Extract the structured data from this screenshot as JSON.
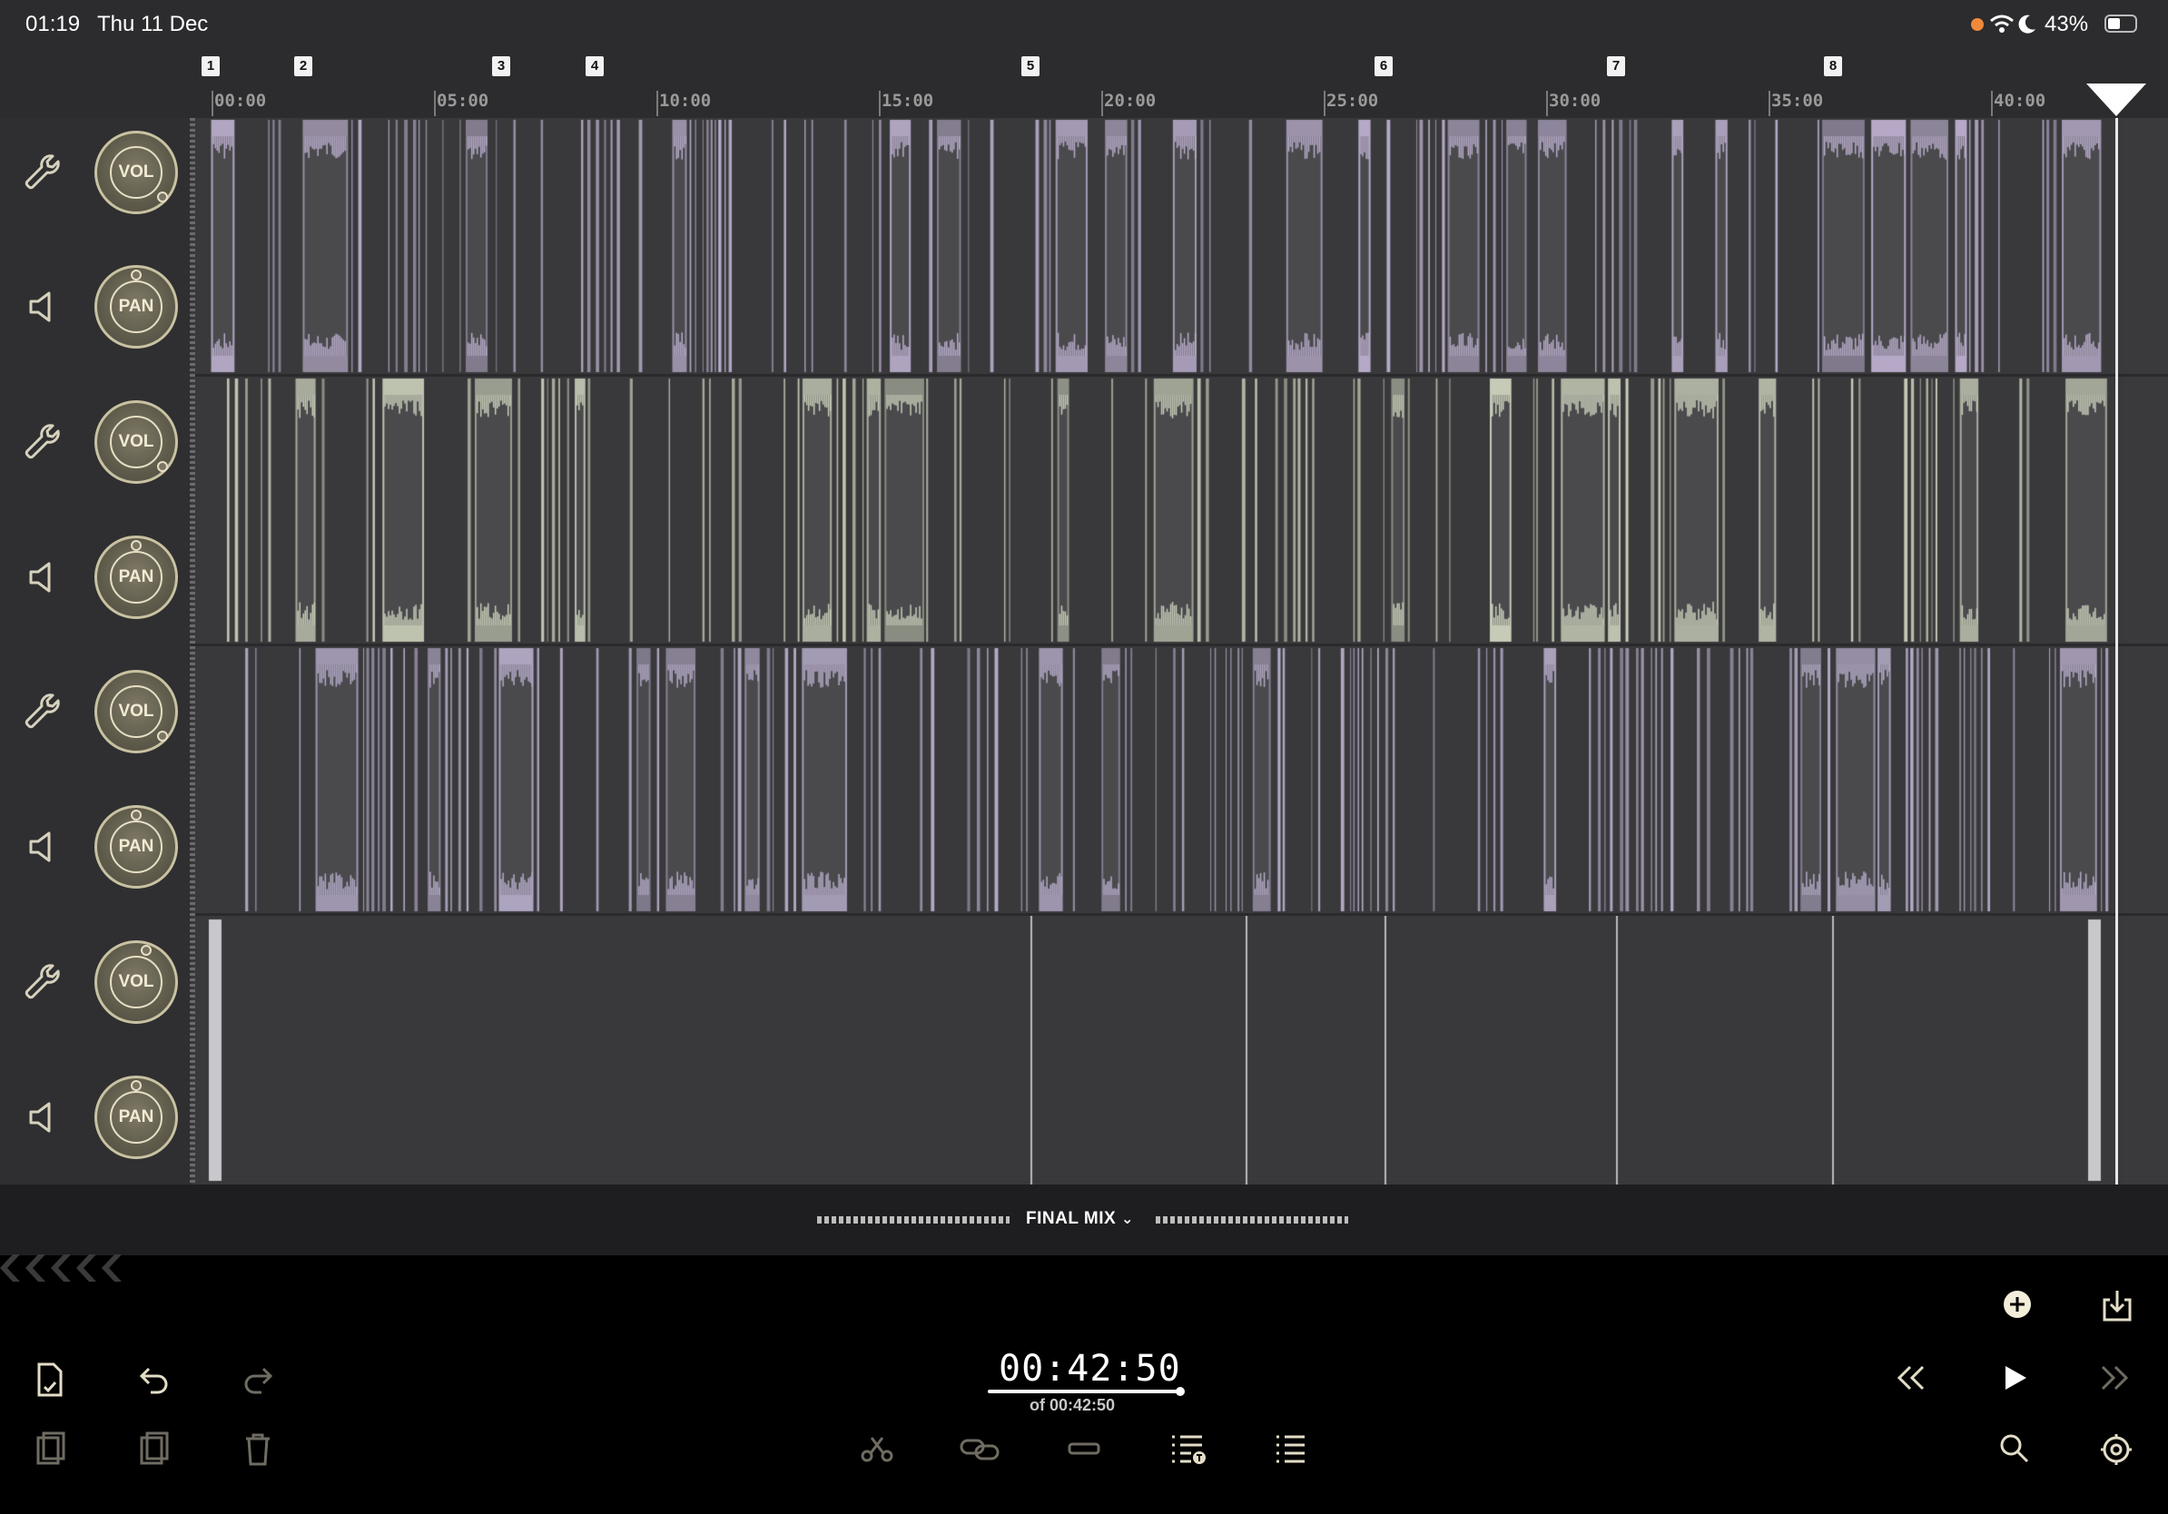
{
  "status_bar": {
    "time": "01:19",
    "date": "Thu 11 Dec",
    "battery": "43%"
  },
  "ruler": {
    "markers": [
      "1",
      "2",
      "3",
      "4",
      "5",
      "6",
      "7",
      "8"
    ],
    "ticks": [
      "00:00",
      "05:00",
      "10:00",
      "15:00",
      "20:00",
      "25:00",
      "30:00",
      "35:00",
      "40:00"
    ]
  },
  "tracks": [
    {
      "vol_label": "VOL",
      "pan_label": "PAN",
      "clip_color": "#b7abc9"
    },
    {
      "vol_label": "VOL",
      "pan_label": "PAN",
      "clip_color": "#c7cdb8"
    },
    {
      "vol_label": "VOL",
      "pan_label": "PAN",
      "clip_color": "#b5abc8"
    },
    {
      "vol_label": "VOL",
      "pan_label": "PAN",
      "clip_color": "#c8c8cc"
    }
  ],
  "mix": {
    "label": "FINAL MIX"
  },
  "transport": {
    "current_time": "00:42:50",
    "total_time": "of 00:42:50"
  },
  "colors": {
    "accent": "#e3ddc8",
    "knob_ring": "#c9c2a2"
  },
  "icons": {
    "settings": "wrench-icon",
    "speaker": "speaker-icon",
    "add": "plus-circle-icon",
    "export": "download-icon",
    "new": "file-icon",
    "undo": "undo-icon",
    "redo": "redo-icon",
    "copy": "copy-icon",
    "paste": "paste-icon",
    "delete": "trash-icon",
    "cut": "scissors-icon",
    "link": "link-icon",
    "split": "split-icon",
    "list_time": "list-time-icon",
    "list": "list-icon",
    "rewind": "rewind-icon",
    "play": "play-icon",
    "forward": "fast-forward-icon",
    "search": "search-icon",
    "settings_gear": "gear-icon"
  }
}
